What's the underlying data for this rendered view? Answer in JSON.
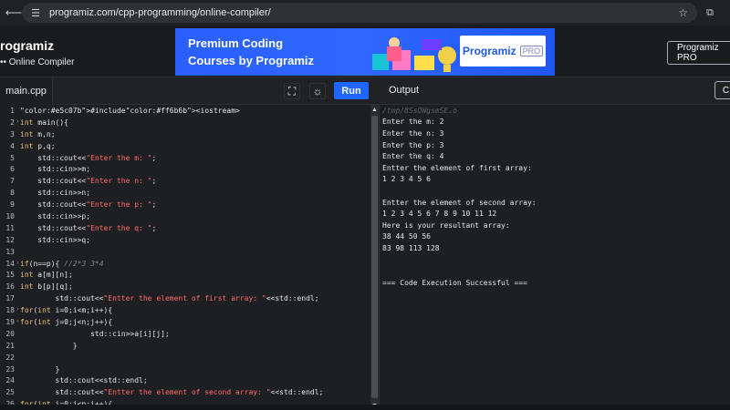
{
  "browser": {
    "url": "programiz.com/cpp-programming/online-compiler/"
  },
  "header": {
    "brand": "rogramiz",
    "subbrand": "•• Online Compiler",
    "banner": {
      "line1": "Premium Coding",
      "line2": "Courses by Programiz",
      "promo_logo": "Programiz",
      "promo_badge": "PRO"
    },
    "pro_button": "Programiz PRO"
  },
  "editor": {
    "tab": "main.cpp",
    "run_label": "Run",
    "lines": [
      {
        "n": "1",
        "text": "#include<iostream>"
      },
      {
        "n": "2",
        "text": "int main(){"
      },
      {
        "n": "3",
        "text": "    int m,n;"
      },
      {
        "n": "4",
        "text": "    int p,q;"
      },
      {
        "n": "5",
        "text": "    std::cout<<\"Enter the m: \";"
      },
      {
        "n": "6",
        "text": "    std::cin>>m;"
      },
      {
        "n": "7",
        "text": "    std::cout<<\"Enter the n: \";"
      },
      {
        "n": "8",
        "text": "    std::cin>>n;"
      },
      {
        "n": "9",
        "text": "    std::cout<<\"Enter the p: \";"
      },
      {
        "n": "10",
        "text": "    std::cin>>p;"
      },
      {
        "n": "11",
        "text": "    std::cout<<\"Enter the q: \";"
      },
      {
        "n": "12",
        "text": "    std::cin>>q;"
      },
      {
        "n": "13",
        "text": ""
      },
      {
        "n": "14",
        "text": "    if(n==p){ //2*3 3*4"
      },
      {
        "n": "15",
        "text": "        int a[m][n];"
      },
      {
        "n": "16",
        "text": "        int b[p][q];"
      },
      {
        "n": "17",
        "text": "        std::cout<<\"Entter the element of first array: \"<<std::endl;"
      },
      {
        "n": "18",
        "text": "        for(int i=0;i<m;i++){"
      },
      {
        "n": "19",
        "text": "            for(int j=0;j<n;j++){"
      },
      {
        "n": "20",
        "text": "                std::cin>>a[i][j];"
      },
      {
        "n": "21",
        "text": "            }"
      },
      {
        "n": "22",
        "text": ""
      },
      {
        "n": "23",
        "text": "        }"
      },
      {
        "n": "24",
        "text": "        std::cout<<std::endl;"
      },
      {
        "n": "25",
        "text": "        std::cout<<\"Entter the element of second array: \"<<std::endl;"
      },
      {
        "n": "26",
        "text": "        for(int i=0;i<p;i++){"
      }
    ]
  },
  "output": {
    "title": "Output",
    "clear_label": "C",
    "lines": [
      {
        "text": "/tmp/8SsOWgsmSE.o",
        "dim": true
      },
      {
        "text": "Enter the m: 2"
      },
      {
        "text": "Enter the n: 3"
      },
      {
        "text": "Enter the p: 3"
      },
      {
        "text": "Enter the q: 4"
      },
      {
        "text": "Entter the element of first array:"
      },
      {
        "text": "1 2 3 4 5 6"
      },
      {
        "text": ""
      },
      {
        "text": "Entter the element of second array:"
      },
      {
        "text": "1 2 3 4 5 6 7 8 9 10 11 12"
      },
      {
        "text": "Here is your resultant array:"
      },
      {
        "text": "38 44 50 56"
      },
      {
        "text": "83 98 113 128"
      },
      {
        "text": ""
      },
      {
        "text": ""
      },
      {
        "text": "=== Code Execution Successful ==="
      }
    ]
  }
}
